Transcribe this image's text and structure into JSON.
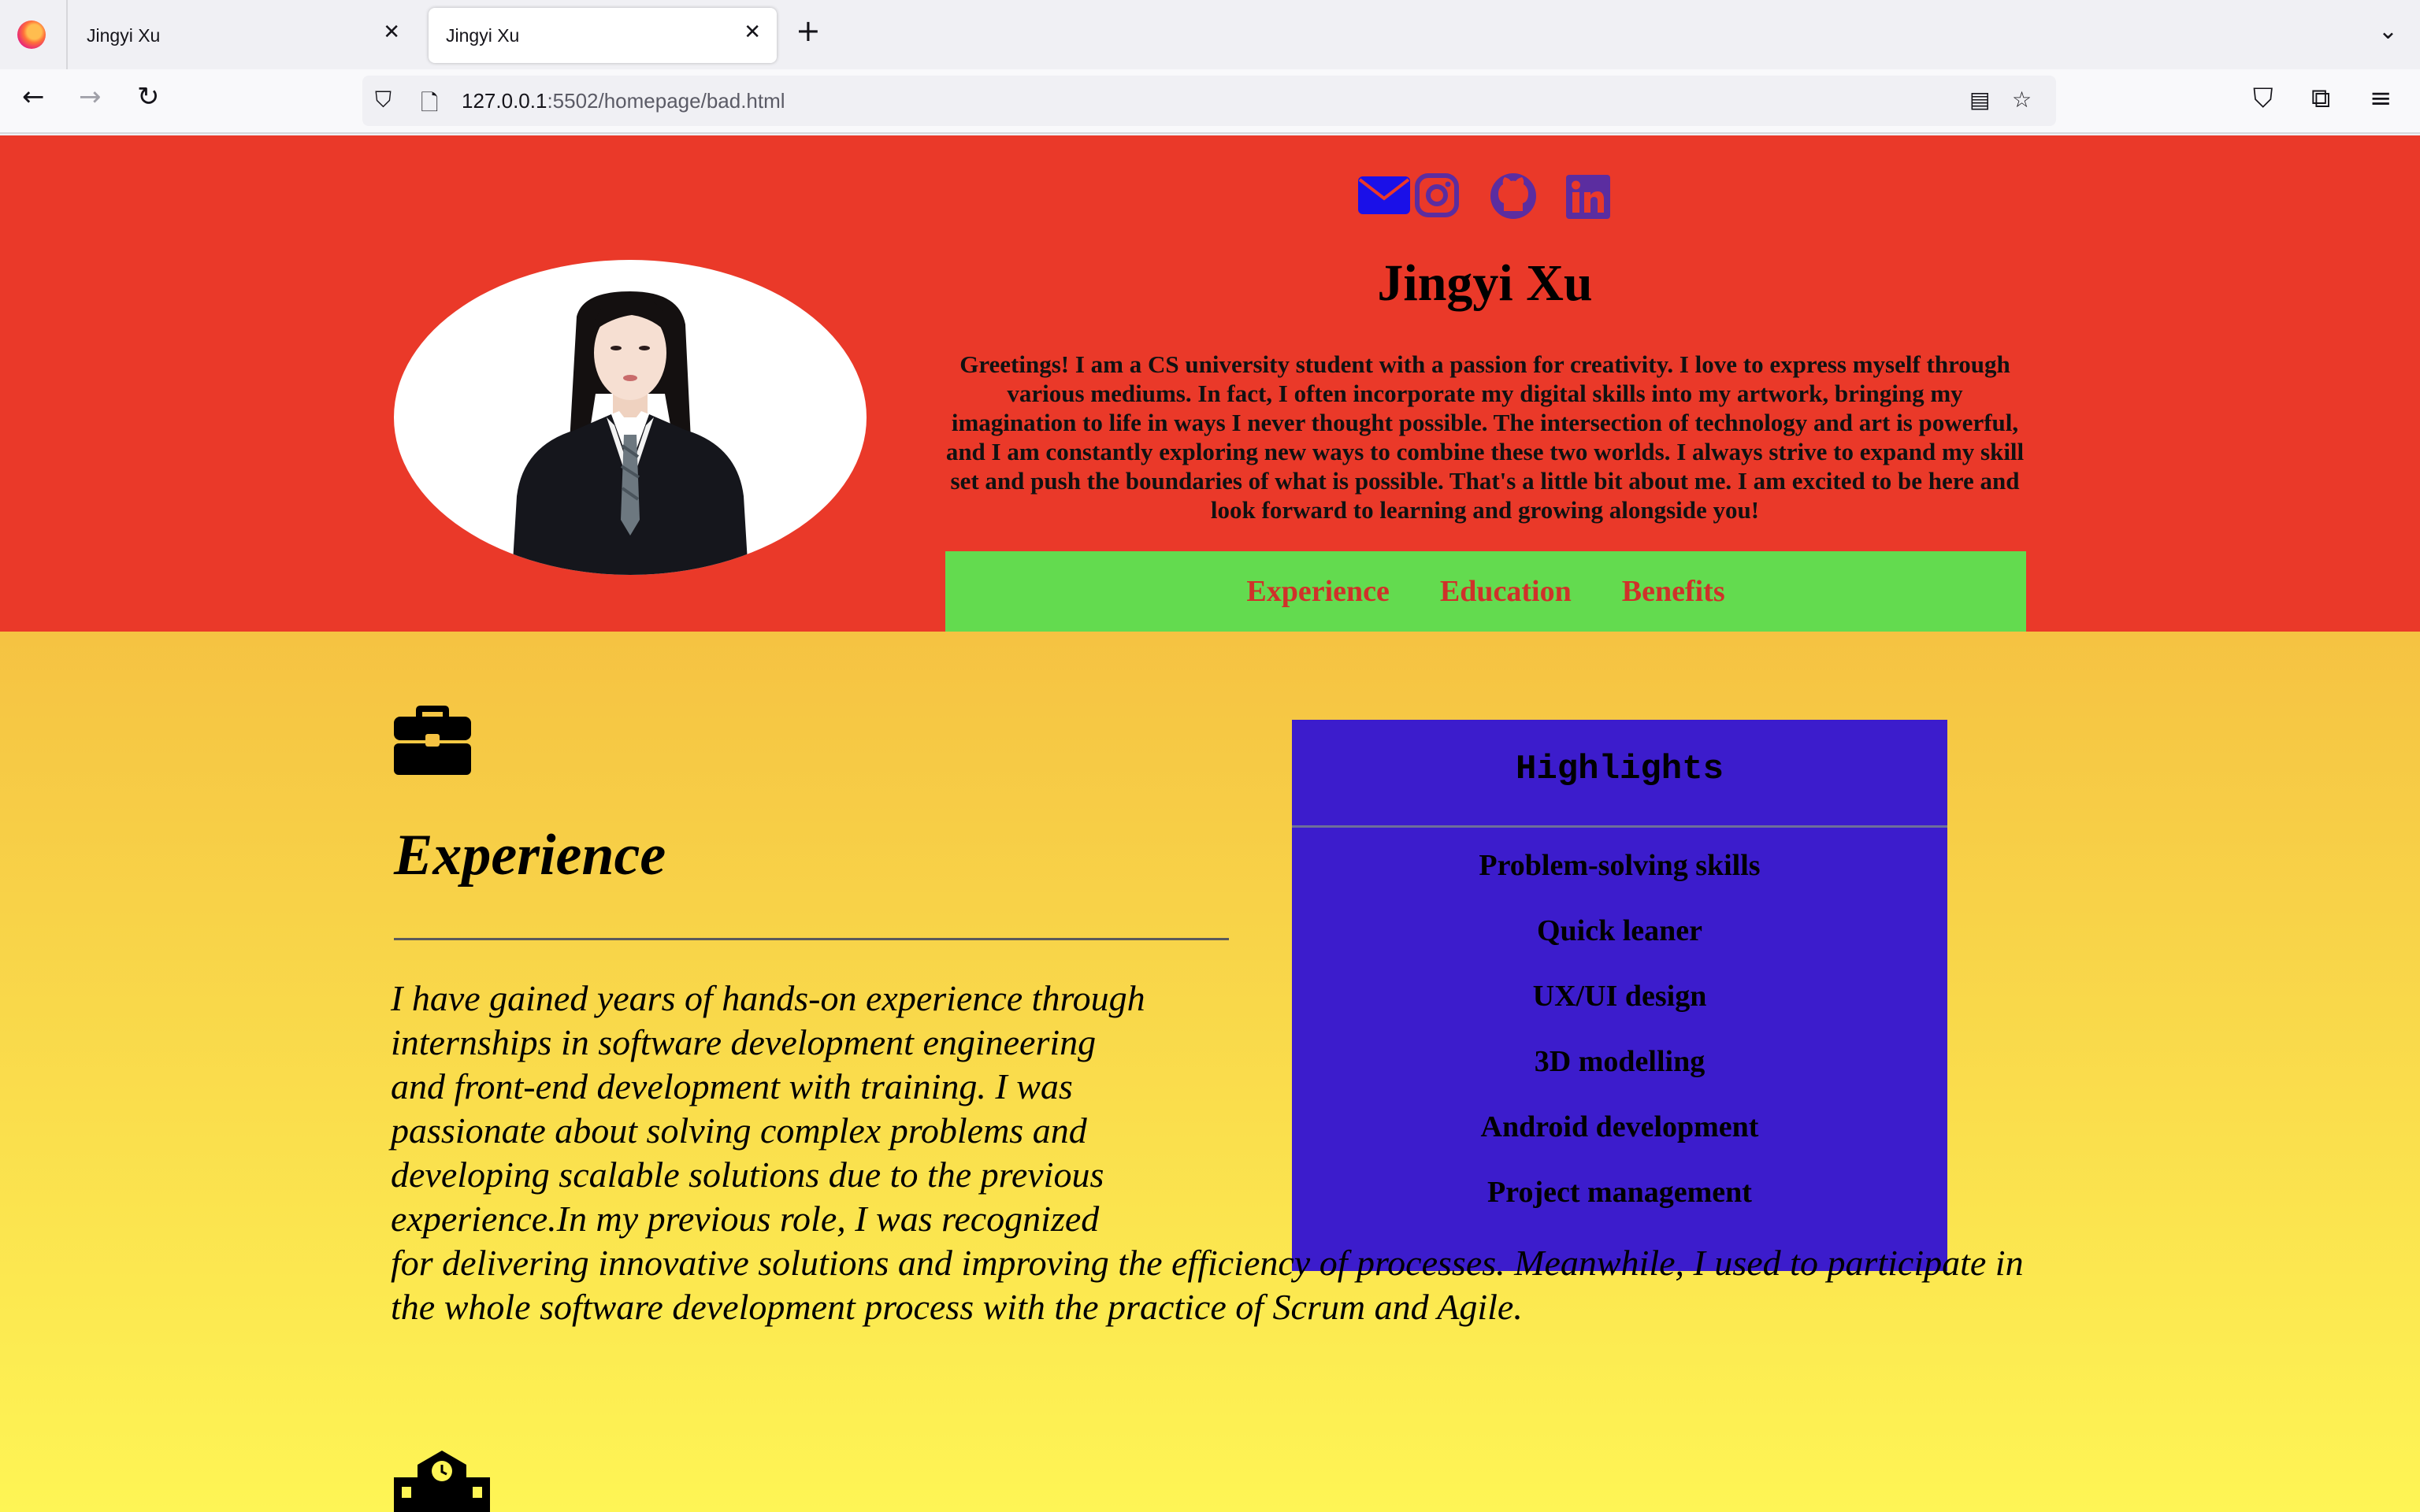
{
  "browser": {
    "tabs": [
      {
        "title": "Jingyi Xu",
        "active": false
      },
      {
        "title": "Jingyi Xu",
        "active": true
      }
    ],
    "url_host": "127.0.0.1",
    "url_rest": ":5502/homepage/bad.html"
  },
  "profile": {
    "name": "Jingyi Xu",
    "bio": "Greetings! I am a CS university student with a passion for creativity. I love to express myself through various mediums. In fact, I often incorporate my digital skills into my artwork, bringing my imagination to life in ways I never thought possible. The intersection of technology and art is powerful, and I am constantly exploring new ways to combine these two worlds. I always strive to expand my skill set and push the boundaries of what is possible. That's a little bit about me. I am excited to be here and look forward to learning and growing alongside you!",
    "social_icons": [
      "envelope-icon",
      "instagram-icon",
      "github-icon",
      "linkedin-icon"
    ]
  },
  "nav": {
    "items": [
      "Experience",
      "Education",
      "Benefits"
    ]
  },
  "experience": {
    "title": "Experience",
    "text": "I have gained years of hands-on experience through internships in software development engineering and front-end development with training. I was passionate about solving complex problems and developing scalable solutions due to the previous experience.In my previous role, I was recognized for delivering innovative solutions and improving the efficiency of processes. Meanwhile, I used to participate in the whole software development process with the practice of Scrum and Agile."
  },
  "highlights": {
    "title": "Highlights",
    "items": [
      "Problem-solving skills",
      "Quick leaner",
      "UX/UI design",
      "3D modelling",
      "Android development",
      "Project management"
    ]
  },
  "colors": {
    "header_bg": "#ea3929",
    "nav_bg": "#63db4f",
    "nav_link": "#d0312a",
    "highlights_bg": "#3c1ccc",
    "icon_blue": "#1a10e8",
    "icon_purple": "#5b2da0",
    "gradient_top": "#f5c242",
    "gradient_bottom": "#fef555"
  }
}
